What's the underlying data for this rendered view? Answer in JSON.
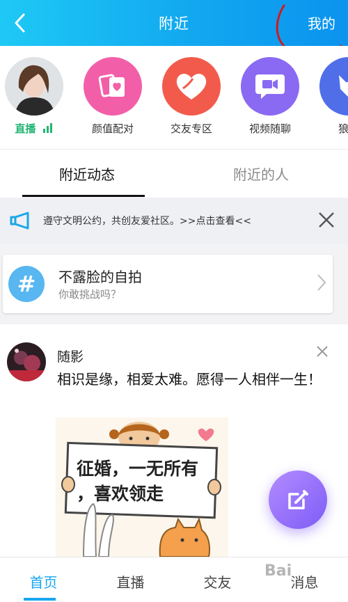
{
  "header": {
    "title": "附近",
    "mine_label": "我的",
    "gradient_start": "#1ec9f5",
    "gradient_end": "#0b93ee"
  },
  "quick_entries": [
    {
      "label": "直播",
      "icon": "live-avatar",
      "color": "#22b573"
    },
    {
      "label": "颜值配对",
      "icon": "cards-heart-icon",
      "color": "#f25fa8"
    },
    {
      "label": "交友专区",
      "icon": "heart-icon",
      "color": "#f25b4c"
    },
    {
      "label": "视频随聊",
      "icon": "video-chat-icon",
      "color": "#8a6af2"
    },
    {
      "label": "狼人",
      "icon": "wolf-icon",
      "color": "#4f6ee8"
    }
  ],
  "tabs": [
    {
      "label": "附近动态",
      "active": true
    },
    {
      "label": "附近的人",
      "active": false
    }
  ],
  "notice": {
    "text": "遵守文明公约，共创友爱社区。>>点击查看<<",
    "icon": "megaphone-icon"
  },
  "topic": {
    "symbol": "#",
    "title": "不露脸的自拍",
    "subtitle": "你敢挑战吗？"
  },
  "post": {
    "user": "随影",
    "text": "相识是缘，相爱太难。愿得一人相伴一生！",
    "image_text_line1": "征婚，一无所有",
    "image_text_line2": "，喜欢领走"
  },
  "bottom_nav": [
    {
      "label": "首页",
      "active": true
    },
    {
      "label": "直播",
      "active": false
    },
    {
      "label": "交友",
      "active": false
    },
    {
      "label": "消息",
      "active": false
    }
  ],
  "watermark": "Bai"
}
